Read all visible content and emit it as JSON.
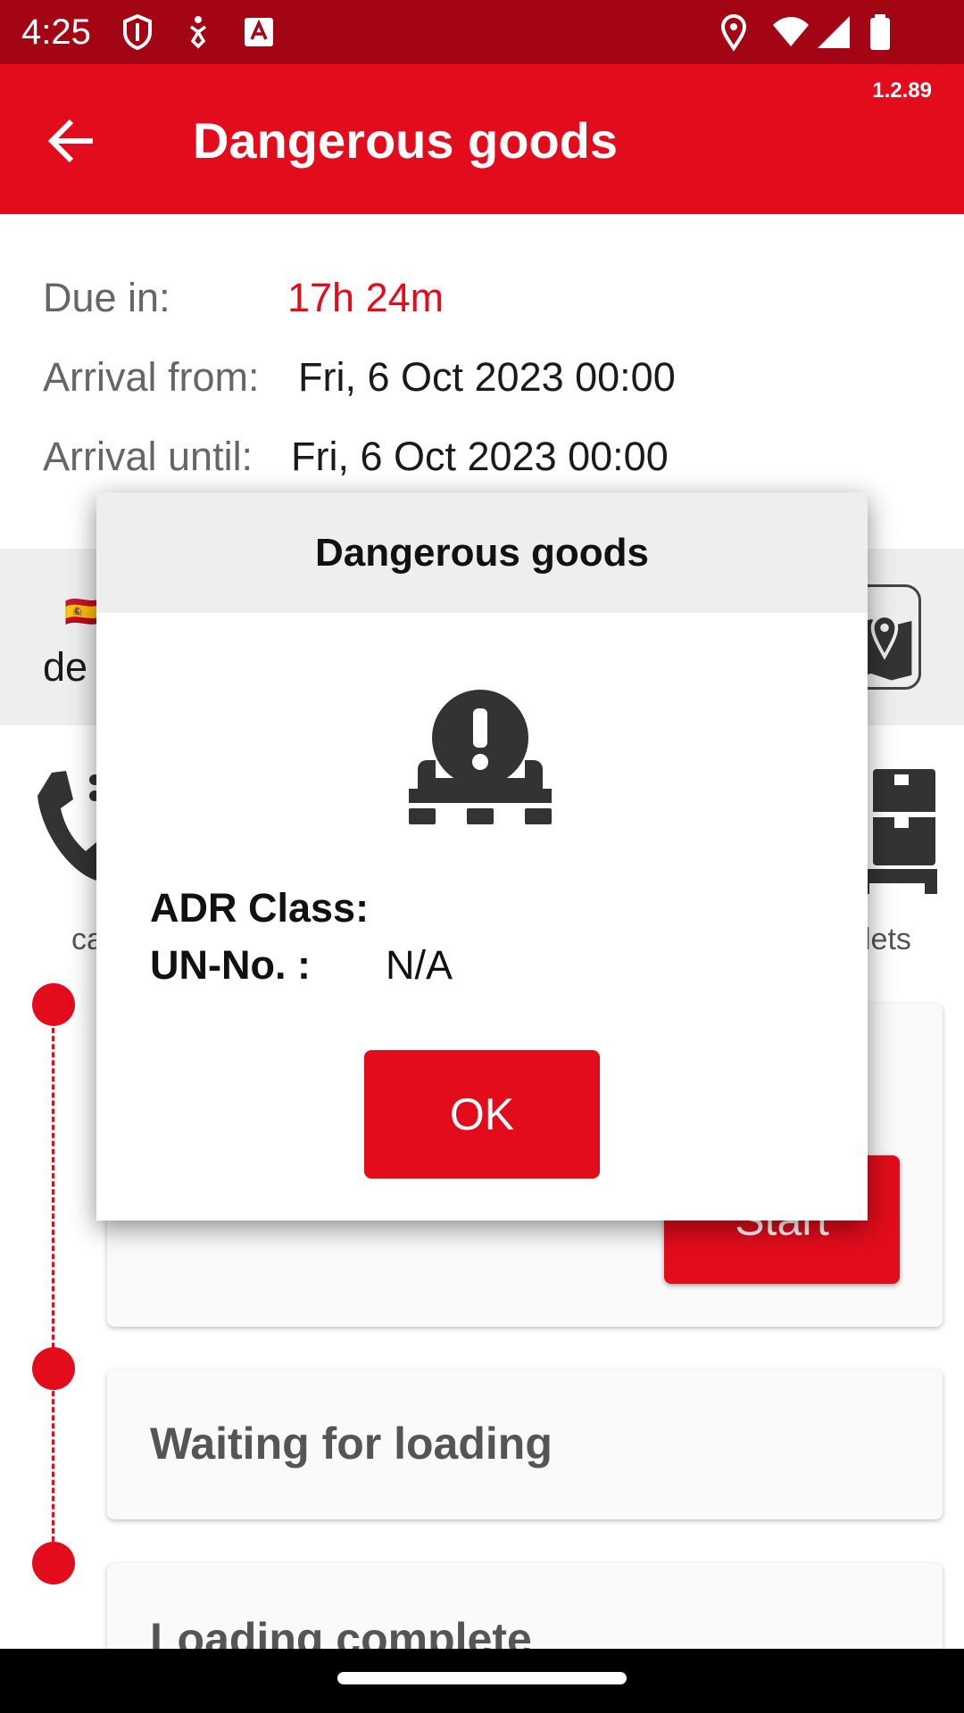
{
  "status_bar": {
    "time": "4:25",
    "left_icons": [
      "shield-icon",
      "accessibility-icon",
      "keyboard-a-icon"
    ],
    "right_icons": [
      "location-icon",
      "wifi-icon",
      "signal-icon",
      "battery-icon"
    ]
  },
  "app_bar": {
    "title": "Dangerous goods",
    "version": "1.2.89",
    "back_icon": "arrow-back-icon",
    "color": "#e20c1c"
  },
  "info": {
    "due_label": "Due in:",
    "due_value": "17h 24m",
    "arrival_from_label": "Arrival from:",
    "arrival_from_value": "Fri, 6 Oct 2023 00:00",
    "arrival_until_label": "Arrival until:",
    "arrival_until_value": "Fri, 6 Oct 2023 00:00"
  },
  "address": {
    "flag": "🇪🇸",
    "text_partial": "de",
    "map_icon": "map-pin-icon"
  },
  "actions": {
    "call_label_partial": "ca",
    "pallets_label_partial": "lets"
  },
  "timeline": {
    "start_button": "Start",
    "steps": [
      {
        "title": "Waiting for loading"
      },
      {
        "title": "Loading complete"
      }
    ]
  },
  "dialog": {
    "title": "Dangerous goods",
    "icon": "dangerous-goods-pallet-icon",
    "adr_label": "ADR Class:",
    "adr_value": "",
    "un_label": "UN-No. :",
    "un_value": "N/A",
    "ok_button": "OK"
  }
}
